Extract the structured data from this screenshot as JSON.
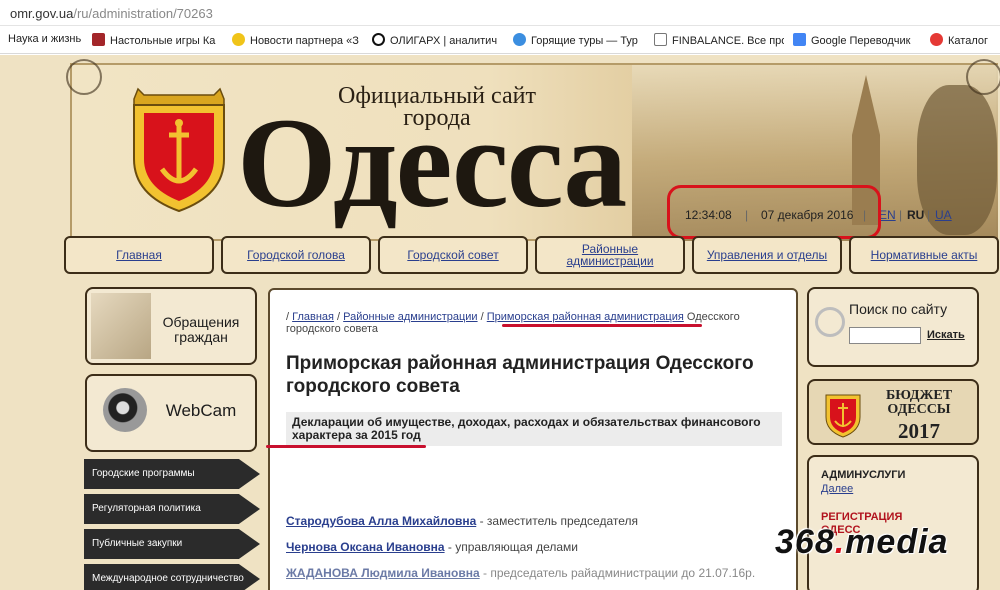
{
  "browser": {
    "url_host": "omr.gov.ua",
    "url_path": "/ru/administration/70263",
    "bookmarks": [
      {
        "label": "Наука и жизнь",
        "color": "#ffffff"
      },
      {
        "label": "Настольные игры Ка",
        "color": "#a3262a"
      },
      {
        "label": "Новости партнера «З",
        "color": "#f0c419"
      },
      {
        "label": "ОЛИГАРХ | аналитич",
        "color": "#111111"
      },
      {
        "label": "Горящие туры — Тур",
        "color": "#3b8ee0"
      },
      {
        "label": "FINBALANCE. Все про",
        "color": "#ffffff"
      },
      {
        "label": "Google Переводчик",
        "color": "#4285f4"
      },
      {
        "label": "Каталог",
        "color": "#e53935"
      }
    ]
  },
  "header": {
    "subtitle": "Официальный сайт города",
    "title": "Одесса",
    "time": "12:34:08",
    "date": "07 декабря 2016",
    "lang_en": "EN",
    "lang_ru": "RU",
    "lang_ua": "UA"
  },
  "nav": [
    "Главная",
    "Городской голова",
    "Городской совет",
    "Районные администрации",
    "Управления и отделы",
    "Нормативные акты"
  ],
  "left": {
    "appeals": "Обращения граждан",
    "webcam": "WebCam",
    "menu": [
      "Городские программы",
      "Регуляторная политика",
      "Публичные закупки",
      "Международное сотрудничество"
    ]
  },
  "content": {
    "crumb_home": "Главная",
    "crumb_districts": "Районные администрации",
    "crumb_current_link": "Приморская районная администрация",
    "crumb_current_rest": "Одесского городского совета",
    "title": "Приморская районная администрация Одесского городского совета",
    "declarations": "Декларации об имуществе, доходах, расходах и обязательствах финансового характера за 2015 год",
    "people": [
      {
        "name": "Стародубова Алла Михайловна",
        "role": "- заместитель председателя"
      },
      {
        "name": "Чернова Оксана Ивановна",
        "role": "- управляющая делами"
      },
      {
        "name": "ЖАДАНОВА Людмила Ивановна",
        "role": "- председатель райадминистрации до 21.07.16р."
      }
    ]
  },
  "right": {
    "search_title": "Поиск по сайту",
    "search_value": "",
    "search_button": "Искать",
    "budget_line1": "БЮДЖЕТ ОДЕССЫ",
    "budget_year": "2017",
    "services_title": "АДМИНУСЛУГИ",
    "services_more": "Далее",
    "registration_title": "РЕГИСТРАЦИЯ",
    "registration_sub": "ОДЕСС"
  },
  "watermark": {
    "main": "368",
    "suffix": ".media",
    "dot": "."
  },
  "colors": {
    "accent_red": "#d8121b",
    "link_blue": "#2a3f8e",
    "site_bg": "#efe2c3"
  }
}
